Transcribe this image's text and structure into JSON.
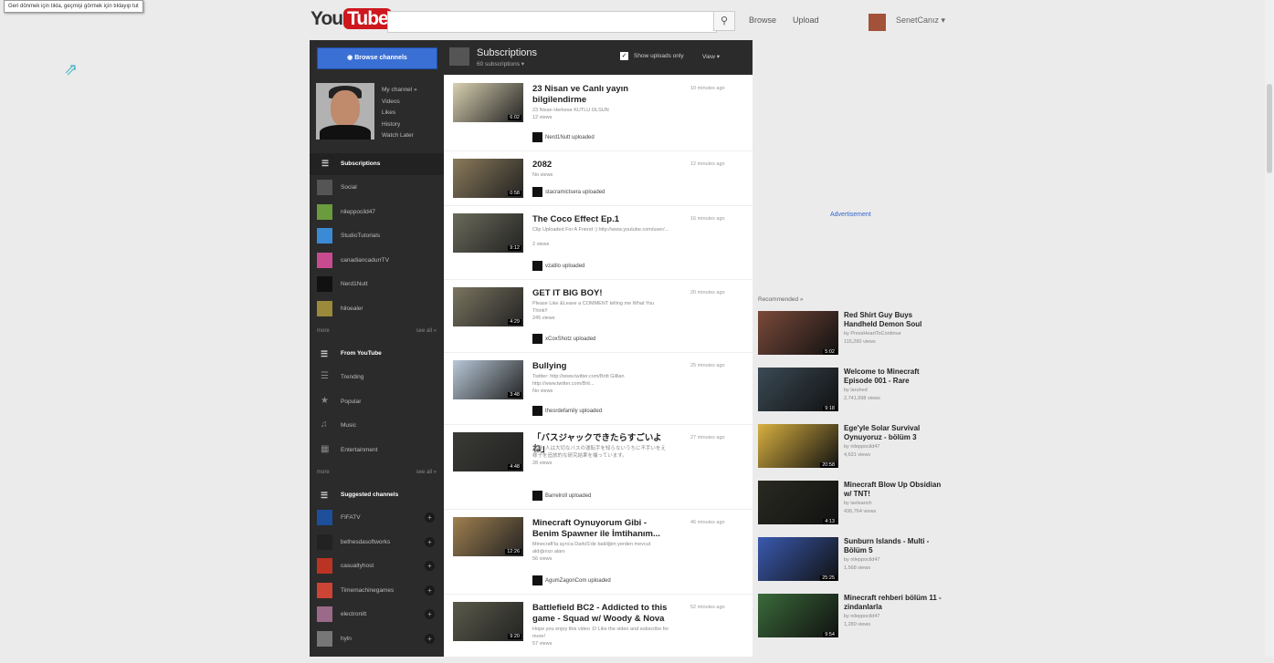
{
  "tooltip": "Geri dönmek için tıkla, geçmişi görmek için tıklayıp tut",
  "header": {
    "logo_you": "You",
    "logo_tube": "Tube",
    "search_placeholder": "",
    "browse": "Browse",
    "upload": "Upload",
    "username": "SenetCanız ▾"
  },
  "guide": {
    "browse_channels": "Browse channels",
    "profile_links": [
      "My channel »",
      "Videos",
      "Likes",
      "History",
      "Watch Later"
    ],
    "subscriptions_label": "Subscriptions",
    "subscriptions": [
      {
        "label": "Social",
        "color": "#555"
      },
      {
        "label": "nileppocild47",
        "color": "#6a9b3e"
      },
      {
        "label": "StudioTutorials",
        "color": "#3b8ad6"
      },
      {
        "label": "canadiancadurrTV",
        "color": "#c84b8f"
      },
      {
        "label": "Nerd1Nutt",
        "color": "#111"
      },
      {
        "label": "hiloealer",
        "color": "#9b8a3a"
      }
    ],
    "more_label": "more",
    "see_all_label": "see all »",
    "from_youtube_label": "From YouTube",
    "from_youtube": [
      {
        "label": "Trending",
        "icon": "☰"
      },
      {
        "label": "Popular",
        "icon": "★"
      },
      {
        "label": "Music",
        "icon": "♫"
      },
      {
        "label": "Entertainment",
        "icon": "▦"
      }
    ],
    "suggested_label": "Suggested channels",
    "suggested": [
      {
        "label": "FIFATV",
        "color": "#1d4f9b"
      },
      {
        "label": "bethesdasoftworks",
        "color": "#222"
      },
      {
        "label": "casualtyhost",
        "color": "#b32"
      },
      {
        "label": "Timemachinegames",
        "color": "#c43"
      },
      {
        "label": "electronitt",
        "color": "#9b6a8a"
      },
      {
        "label": "hyln",
        "color": "#777"
      }
    ]
  },
  "feed": {
    "title": "Subscriptions",
    "subcount": "60 subscriptions ▾",
    "show_uploads": "Show uploads only",
    "view": "View ▾",
    "items": [
      {
        "title": "23 Nisan ve Canlı yayın bilgilendirme",
        "desc": "23 Nisan Herkese KUTLU OLSUN",
        "views": "12 views",
        "time": "10 minutes ago",
        "uploader": "Nerd1Nutt uploaded",
        "duration": "6:02",
        "thumb": "#d8d0b0"
      },
      {
        "title": "2082",
        "desc": "",
        "views": "No views",
        "time": "12 minutes ago",
        "uploader": "stacramictsera uploaded",
        "duration": "0:58",
        "thumb": "#8a7a5a"
      },
      {
        "title": "The Coco Effect Ep.1",
        "desc": "Clip Uploaded For A Friend :) http://www.youtube.com/user/...",
        "views": "2 views",
        "time": "16 minutes ago",
        "uploader": "vzatilo uploaded",
        "duration": "9:12",
        "thumb": "#6a6a5a"
      },
      {
        "title": "GET IT BIG BOY!",
        "desc": "Please Like &Leave a COMMENT telling me What You Think!!",
        "views": "245 views",
        "time": "20 minutes ago",
        "uploader": "xCoxShotz uploaded",
        "duration": "4:29",
        "thumb": "#7a7560"
      },
      {
        "title": "Bullying",
        "desc": "Twitter: http://www.twitter.com/Britt Gillian http://www.twitter.com/Brit...",
        "views": "No views",
        "time": "25 minutes ago",
        "uploader": "thesrdefamily uploaded",
        "duration": "3:48",
        "thumb": "#b8c8d8"
      },
      {
        "title": "「バスジャックできたらすごいよね」",
        "desc": "実験: 人は大切なバスの運転手を知らないうちに不手いをえ様子を追放的な研究結果を撮っています。",
        "views": "28 views",
        "time": "27 minutes ago",
        "uploader": "Barrelroll uploaded",
        "duration": "4:48",
        "thumb": "#3a3a36"
      },
      {
        "title": "Minecraft Oynuyorum Gibi - Benim Spawner ile İmtihanım...",
        "desc": "Minecraft'ta ayrıca DarkiS'de bakliğim yerden mevcut aldığınızı alanı",
        "views": "56 views",
        "time": "46 minutes ago",
        "uploader": "AgumZagonCom uploaded",
        "duration": "12:26",
        "thumb": "#a08050"
      },
      {
        "title": "Battlefield BC2 - Addicted to this game - Squad w/ Woody & Nova",
        "desc": "Hope you enjoy this video :D Like the video and subscribe for more!",
        "views": "57 views",
        "time": "52 minutes ago",
        "uploader": "",
        "duration": "9:20",
        "thumb": "#5a5a4a"
      }
    ]
  },
  "sidebar": {
    "ad_label": "Advertisement",
    "recommended_label": "Recommended »",
    "recommended": [
      {
        "title": "Red Shirt Guy Buys Handheld Demon Soul",
        "by": "by PressHeartToContinue",
        "views": "115,260 views",
        "duration": "5:02",
        "thumb": "#7a4a3a"
      },
      {
        "title": "Welcome to Minecraft Episode 001 - Rare",
        "by": "by laruhed",
        "views": "2,741,998 views",
        "duration": "9:18",
        "thumb": "#3a4a55"
      },
      {
        "title": "Ege'yle Solar Survival Oynuyoruz - bölüm 3",
        "by": "by nileppocild47",
        "views": "4,631 views",
        "duration": "20:58",
        "thumb": "#d8b040"
      },
      {
        "title": "Minecraft Blow Up Obsidian w/ TNT!",
        "by": "by iseleanch",
        "views": "436,764 views",
        "duration": "4:13",
        "thumb": "#2a2a22"
      },
      {
        "title": "Sunburn Islands - Multi - Bölüm 5",
        "by": "by nileppocild47",
        "views": "1,568 views",
        "duration": "25:25",
        "thumb": "#3a5ab0"
      },
      {
        "title": "Minecraft rehberi bölüm 11 - zindanlarla",
        "by": "by nileppocild47",
        "views": "1,280 views",
        "duration": "9:54",
        "thumb": "#3a6a3a"
      }
    ]
  }
}
